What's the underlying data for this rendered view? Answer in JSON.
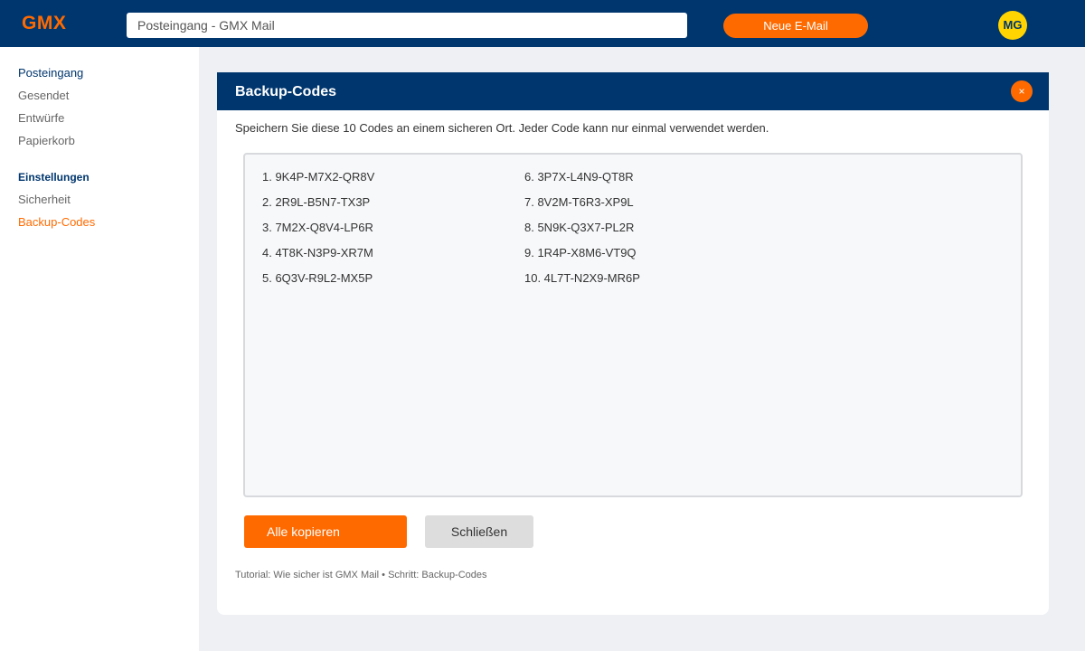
{
  "header": {
    "logo": "GMX",
    "search_value": "Posteingang - GMX Mail",
    "new_mail_label": "Neue E-Mail",
    "avatar_initials": "MG"
  },
  "sidebar": {
    "items": [
      "Posteingang",
      "Gesendet",
      "Entwürfe",
      "Papierkorb"
    ],
    "settings_heading": "Einstellungen",
    "settings_items": [
      "Sicherheit",
      "Backup-Codes"
    ]
  },
  "dialog": {
    "title": "Backup-Codes",
    "close_symbol": "×",
    "instruction": "Speichern Sie diese 10 Codes an einem sicheren Ort. Jeder Code kann nur einmal verwendet werden.",
    "codes": [
      "1. 9K4P-M7X2-QR8V",
      "2. 2R9L-B5N7-TX3P",
      "3. 7M2X-Q8V4-LP6R",
      "4. 4T8K-N3P9-XR7M",
      "5. 6Q3V-R9L2-MX5P",
      "6. 3P7X-L4N9-QT8R",
      "7. 8V2M-T6R3-XP9L",
      "8. 5N9K-Q3X7-PL2R",
      "9. 1R4P-X8M6-VT9Q",
      "10. 4L7T-N2X9-MR6P"
    ],
    "copy_all_label": "Alle kopieren",
    "close_label": "Schließen",
    "footer_note": "Tutorial: Wie sicher ist GMX Mail • Schritt: Backup-Codes"
  },
  "colors": {
    "brand_blue": "#00366e",
    "brand_orange": "#ff6a00",
    "avatar_yellow": "#ffd400"
  },
  "icons": {
    "dialog_close": "close-icon"
  }
}
